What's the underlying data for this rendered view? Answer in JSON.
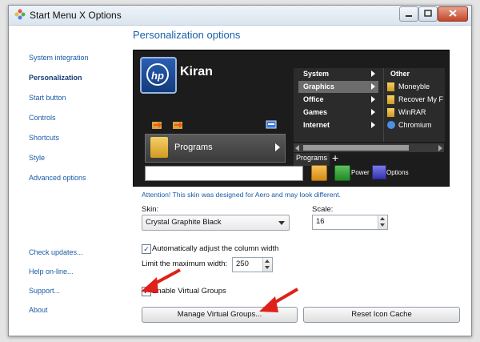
{
  "window": {
    "title": "Start Menu X Options"
  },
  "sidebar": {
    "items": [
      {
        "label": "System integration"
      },
      {
        "label": "Personalization"
      },
      {
        "label": "Start button"
      },
      {
        "label": "Controls"
      },
      {
        "label": "Shortcuts"
      },
      {
        "label": "Style"
      },
      {
        "label": "Advanced options"
      },
      {
        "label": "Check updates..."
      },
      {
        "label": "Help on-line..."
      },
      {
        "label": "Support..."
      },
      {
        "label": "About"
      }
    ]
  },
  "main": {
    "heading": "Personalization options",
    "preview": {
      "logo_text": "hp",
      "user_name": "Kiran",
      "programs_label": "Programs",
      "menu_items": [
        {
          "label": "System"
        },
        {
          "label": "Graphics"
        },
        {
          "label": "Office"
        },
        {
          "label": "Games"
        },
        {
          "label": "Internet"
        }
      ],
      "submenu_items": [
        {
          "label": "Other"
        },
        {
          "label": "Moneyble"
        },
        {
          "label": "Recover My F"
        },
        {
          "label": "WinRAR"
        },
        {
          "label": "Chromium"
        }
      ],
      "tab_label": "Programs",
      "tab_plus": "+",
      "power_label": "Power",
      "options_label": "Options"
    },
    "attention_text": "Attention! This skin was designed for Aero and may look different.",
    "skin": {
      "label": "Skin:",
      "value": "Crystal Graphite Black"
    },
    "scale": {
      "label": "Scale:",
      "value": "16"
    },
    "auto_adjust": {
      "label": "Automatically adjust the column width",
      "checked": true
    },
    "max_width": {
      "label": "Limit the maximum width:",
      "value": "250"
    },
    "virtual_groups": {
      "label": "Enable Virtual Groups",
      "checked": true
    },
    "buttons": {
      "manage": "Manage Virtual Groups...",
      "reset": "Reset Icon Cache"
    }
  },
  "colors": {
    "link": "#1a5aa8",
    "heading": "#1b5fa8",
    "preview_bg": "#1c1c1c",
    "annotation_arrow": "#e0201a"
  }
}
